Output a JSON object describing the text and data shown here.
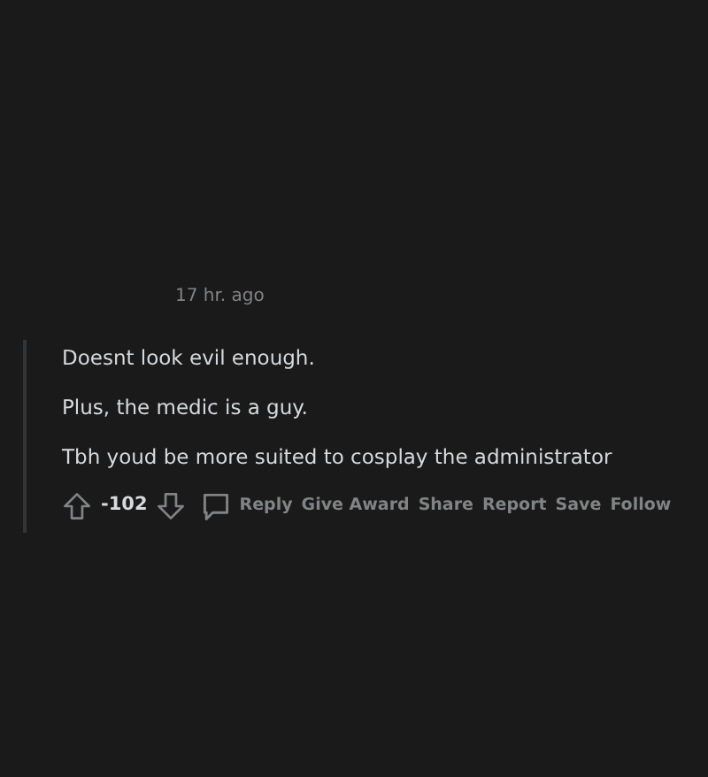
{
  "comment": {
    "timestamp": "17 hr. ago",
    "paragraphs": [
      "Doesnt look evil enough.",
      "Plus, the medic is a guy.",
      "Tbh youd be more suited to cosplay the administrator"
    ],
    "score": "-102",
    "actions": [
      "Reply",
      "Give Award",
      "Share",
      "Report",
      "Save",
      "Follow"
    ]
  }
}
